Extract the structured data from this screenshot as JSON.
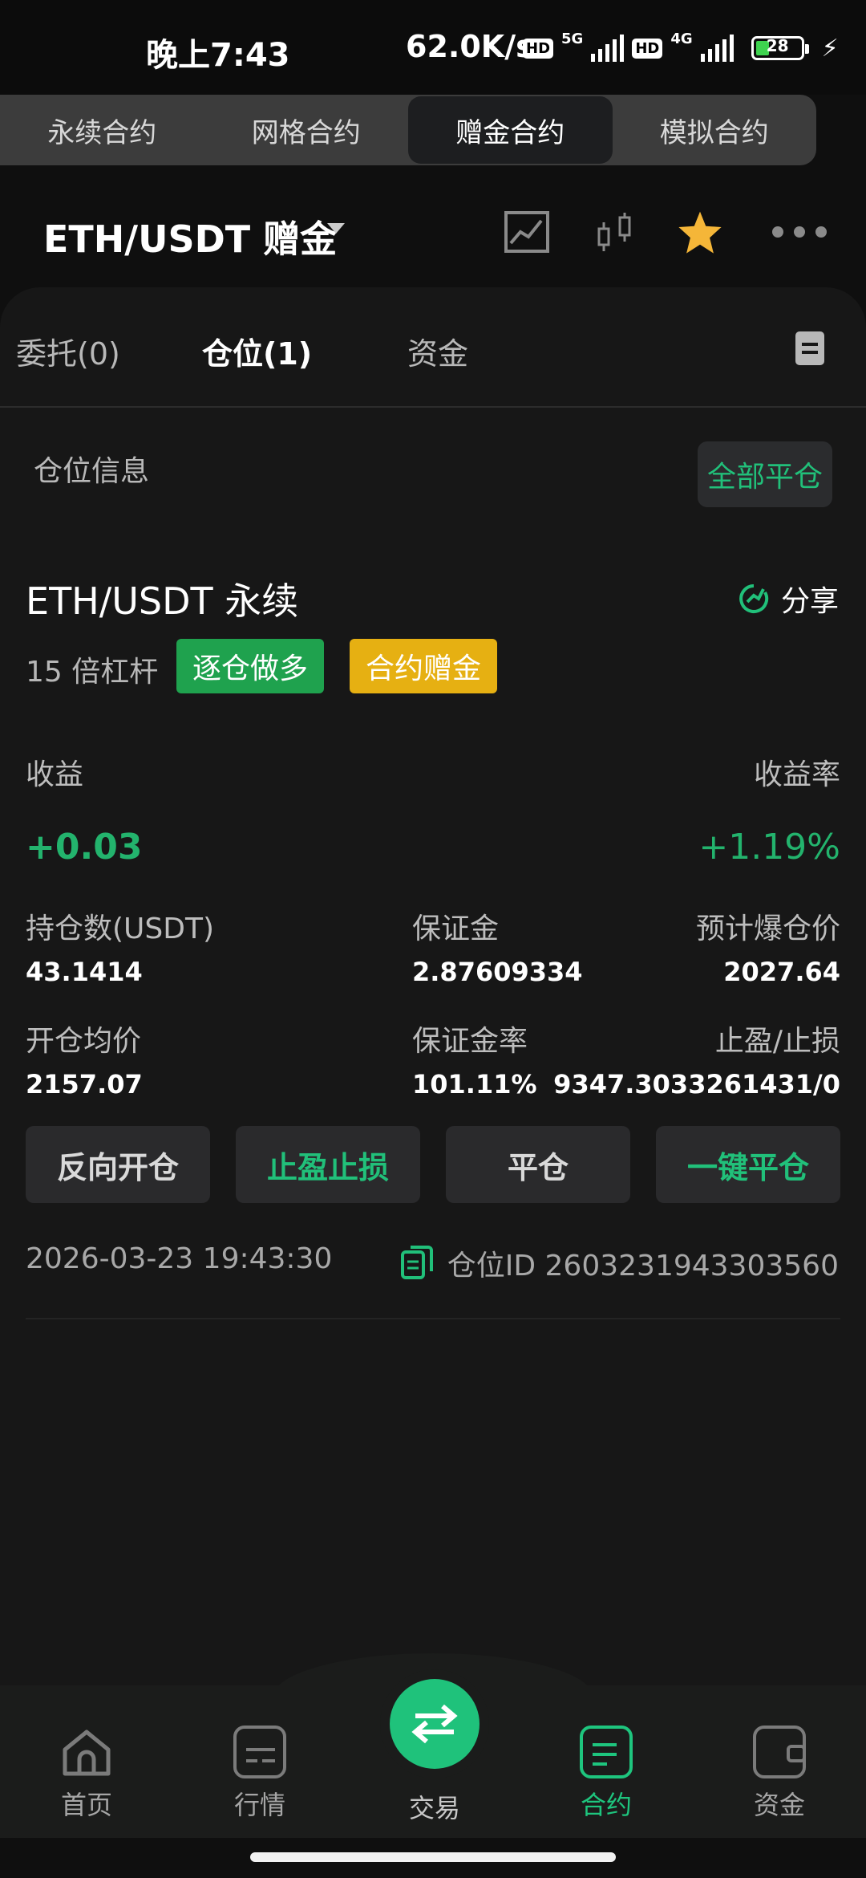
{
  "status_bar": {
    "time": "晚上7:43",
    "speed": "62.0K/s",
    "net1": "5G",
    "net2": "4G",
    "battery": "28"
  },
  "top_tabs": [
    "永续合约",
    "网格合约",
    "赠金合约",
    "模拟合约"
  ],
  "pair": {
    "title": "ETH/USDT  赠金"
  },
  "sub_tabs": {
    "orders": "委托(0)",
    "positions": "仓位(1)",
    "funds": "资金"
  },
  "section": {
    "title": "仓位信息",
    "close_all": "全部平仓"
  },
  "position": {
    "title": "ETH/USDT 永续",
    "share": "分享",
    "leverage": "15 倍杠杆",
    "tag_mode": "逐仓做多",
    "tag_bonus": "合约赠金",
    "pnl_label": "收益",
    "roe_label": "收益率",
    "pnl_value": "+0.03",
    "roe_value": "+1.19%",
    "size_label": "持仓数(USDT)",
    "size_value": "43.1414",
    "margin_label": "保证金",
    "margin_value": "2.87609334",
    "liq_label": "预计爆仓价",
    "liq_value": "2027.64",
    "entry_label": "开仓均价",
    "entry_value": "2157.07",
    "margin_rate_label": "保证金率",
    "margin_rate_value": "101.11%",
    "tpsl_label": "止盈/止损",
    "tpsl_value": "9347.3033261431/0",
    "time": "2026-03-23 19:43:30",
    "id_text": "仓位ID 2603231943303560"
  },
  "buttons": {
    "reverse": "反向开仓",
    "tpsl": "止盈止损",
    "close": "平仓",
    "one_click": "一键平仓"
  },
  "nav": {
    "home": "首页",
    "market": "行情",
    "trade": "交易",
    "contract": "合约",
    "funds": "资金"
  },
  "colors": {
    "accent": "#21c07a",
    "profit": "#23b36d",
    "tag_green": "#1fa24e",
    "tag_yellow": "#e6b012",
    "star": "#f5b638"
  }
}
